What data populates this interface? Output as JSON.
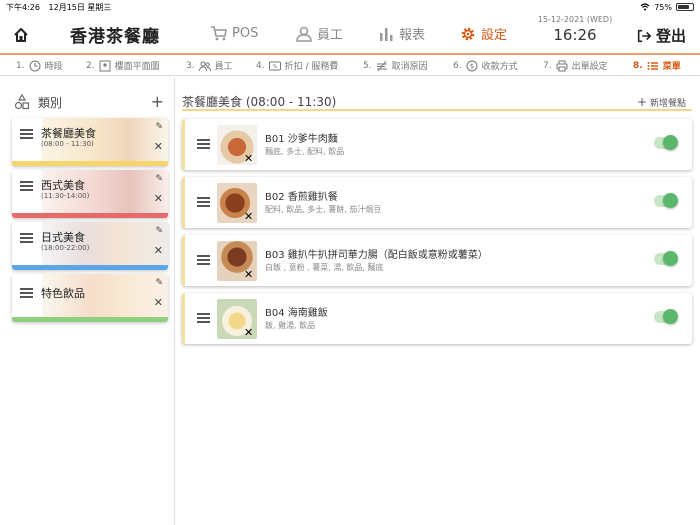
{
  "status": {
    "time": "下午4:26",
    "date": "12月15日 星期三",
    "battery": "75%",
    "battery_level": 0.75
  },
  "header": {
    "title": "香港茶餐廳",
    "nav": [
      {
        "label": "POS",
        "icon": "cart-icon"
      },
      {
        "label": "員工",
        "icon": "person-icon"
      },
      {
        "label": "報表",
        "icon": "bar-chart-icon"
      },
      {
        "label": "設定",
        "icon": "gear-icon",
        "active": true
      }
    ],
    "date": "15-12-2021 (WED)",
    "time": "16:26",
    "logout": "登出"
  },
  "steps": [
    {
      "label": "1. ",
      "name": "時段",
      "icon": "clock-icon"
    },
    {
      "label": "2. ",
      "name": "樓面平面圖",
      "icon": "floorplan-icon"
    },
    {
      "label": "3. ",
      "name": "員工",
      "icon": "people-icon"
    },
    {
      "label": "4. ",
      "name": "折扣 / 服務費",
      "icon": "discount-icon"
    },
    {
      "label": "5. ",
      "name": "取消原因",
      "icon": "cancel-reason-icon"
    },
    {
      "label": "6. ",
      "name": "收款方式",
      "icon": "dollar-icon"
    },
    {
      "label": "7. ",
      "name": "出單設定",
      "icon": "printer-icon"
    },
    {
      "label": "8. ",
      "name": "菜單",
      "icon": "list-icon",
      "active": true
    }
  ],
  "categories": {
    "title": "類別",
    "items": [
      {
        "name": "茶餐廳美食",
        "time": "(08:00 - 11:30)",
        "color": "#f6d66a"
      },
      {
        "name": "西式美食",
        "time": "(11:30-14:00)",
        "color": "#e56b6b"
      },
      {
        "name": "日式美食",
        "time": "(18:00-22:00)",
        "color": "#5aa6e8"
      },
      {
        "name": "特色飲品",
        "time": "",
        "color": "#8fcf7d"
      }
    ]
  },
  "menu": {
    "title": "茶餐廳美食 (08:00 - 11:30)",
    "add_label": "新增餐點",
    "items": [
      {
        "name": "B01 沙爹牛肉麵",
        "tags": "麵底, 多士, 配料, 飲品",
        "enabled": true
      },
      {
        "name": "B02 香煎雞扒餐",
        "tags": "配料, 飲品, 多士, 薯餅, 茄汁焗豆",
        "enabled": true
      },
      {
        "name": "B03 雞扒牛扒拼司華力腸（配白飯或意粉或薯菜）",
        "tags": "白飯 , 意粉 , 薯菜, 湯, 飲品, 麵底",
        "enabled": true
      },
      {
        "name": "B04 海南雞飯",
        "tags": "飯, 雞湯, 飲品",
        "enabled": true
      }
    ]
  },
  "colors": {
    "accent": "#d85a14",
    "toggle_on": "#5bb86a"
  }
}
